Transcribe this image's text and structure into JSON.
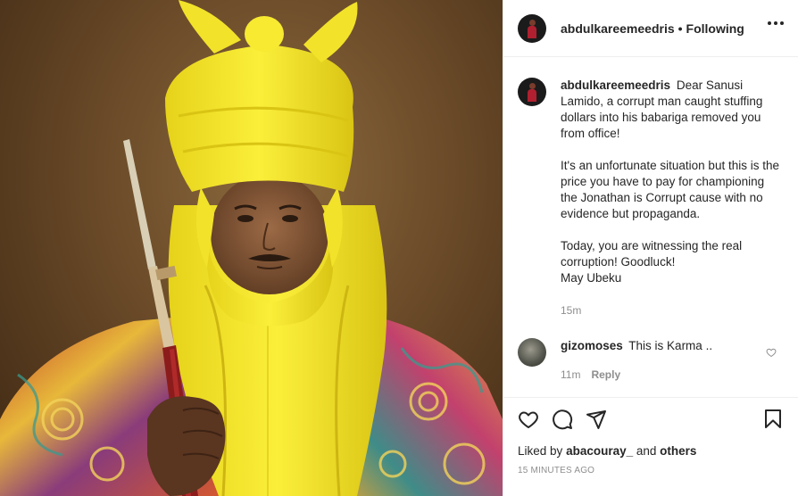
{
  "post": {
    "image_alt": "Portrait of a man in a yellow turban and embroidered robe holding a staff",
    "author": {
      "username": "abdulkareemeedris",
      "separator": "•",
      "follow_status": "Following"
    },
    "caption": {
      "username": "abdulkareemeedris",
      "paragraphs": [
        "Dear Sanusi Lamido, a corrupt man caught stuffing dollars into his babariga removed you from office!",
        "It's an unfortunate situation but this is the price you have to pay for championing the Jonathan is Corrupt cause with no evidence but propaganda.",
        "Today, you are witnessing the real corruption! Goodluck!\nMay Ubeku"
      ],
      "age": "15m"
    },
    "comments": [
      {
        "username": "gizomoses",
        "text": "This is Karma ..",
        "age": "11m",
        "reply_label": "Reply"
      }
    ],
    "likes": {
      "prefix": "Liked by",
      "user": "abacouray_",
      "joiner": "and",
      "others": "others"
    },
    "timestamp": "15 MINUTES AGO",
    "icons": [
      "heart-icon",
      "comment-icon",
      "share-icon",
      "bookmark-icon",
      "more-options-icon"
    ]
  }
}
